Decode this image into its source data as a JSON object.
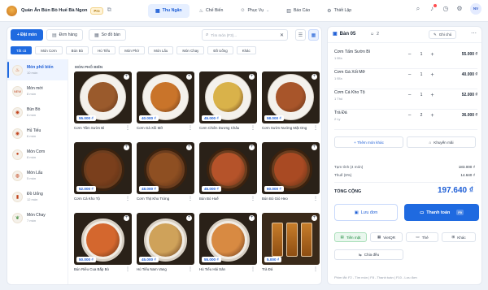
{
  "brand": {
    "name": "Quán Ăn Bún Bò Huế Bà Ngon",
    "badge": "Pro"
  },
  "nav": [
    {
      "label": "Thu Ngân",
      "active": true
    },
    {
      "label": "Chế Biến"
    },
    {
      "label": "Phục Vụ"
    },
    {
      "label": "Báo Cáo"
    },
    {
      "label": "Thiết Lập"
    }
  ],
  "user": {
    "initials": "NV"
  },
  "toolbar": {
    "new_order": "+ Đặt món",
    "orders": "Đơn hàng",
    "table_map": "Sơ đồ bàn",
    "search_placeholder": "Tìm món (F3)..."
  },
  "categories": [
    {
      "label": "Tất cả",
      "active": true
    },
    {
      "label": "Món Cơm"
    },
    {
      "label": "Bún Bò"
    },
    {
      "label": "Hủ Tiếu"
    },
    {
      "label": "Món Phở"
    },
    {
      "label": "Món Lẩu"
    },
    {
      "label": "Món Chay"
    },
    {
      "label": "Đồ Uống"
    },
    {
      "label": "Khác"
    }
  ],
  "sidebar": [
    {
      "name": "Món phổ biến",
      "count": "10 món",
      "active": true
    },
    {
      "name": "Món mới",
      "count": "8 món"
    },
    {
      "name": "Bún Bò",
      "count": "6 món"
    },
    {
      "name": "Hủ Tiếu",
      "count": "6 món"
    },
    {
      "name": "Món Cơm",
      "count": "8 món"
    },
    {
      "name": "Món Lẩu",
      "count": "5 món"
    },
    {
      "name": "Đồ Uống",
      "count": "12 món"
    },
    {
      "name": "Món Chay",
      "count": "7 món"
    }
  ],
  "section_title": "MÓN PHỔ BIẾN",
  "menu_items": [
    {
      "name": "Cơm Tấm Sườn Bì",
      "price": "55.000 ₫",
      "color": "#9a5a2c"
    },
    {
      "name": "Cơm Gà Xối Mỡ",
      "price": "40.000 ₫",
      "color": "#c9742a"
    },
    {
      "name": "Cơm Chiên Dương Châu",
      "price": "45.000 ₫",
      "color": "#d9b24a"
    },
    {
      "name": "Cơm Sườn Nướng Mật Ong",
      "price": "58.000 ₫",
      "color": "#a8552a"
    },
    {
      "name": "Cơm Cá Kho Tộ",
      "price": "52.000 ₫",
      "color": "#7a3f1c"
    },
    {
      "name": "Cơm Thịt Kho Trứng",
      "price": "48.000 ₫",
      "color": "#8e4f22"
    },
    {
      "name": "Bún Bò Huế",
      "price": "45.000 ₫",
      "color": "#b5532a"
    },
    {
      "name": "Bún Bò Giò Heo",
      "price": "60.000 ₫",
      "color": "#a94a23"
    },
    {
      "name": "Bún Riêu Cua Bắp Bò",
      "price": "50.000 ₫",
      "color": "#d4672e"
    },
    {
      "name": "Hủ Tiếu Nam Vang",
      "price": "45.000 ₫",
      "color": "#cfa25a"
    },
    {
      "name": "Hủ Tiếu Hải Sản",
      "price": "55.000 ₫",
      "color": "#d88a42"
    },
    {
      "name": "Trà Đá",
      "price": "5.000 ₫",
      "color": "#a86420"
    }
  ],
  "order": {
    "table": "Bàn 05",
    "guests": "2",
    "note_label": "Ghi chú",
    "items": [
      {
        "name": "Cơm Tấm Sườn Bì",
        "unit": "1 Đĩa",
        "qty": "1",
        "price": "55.000 ₫"
      },
      {
        "name": "Cơm Gà Xối Mỡ",
        "unit": "1 Đĩa",
        "qty": "1",
        "price": "40.000 ₫"
      },
      {
        "name": "Cơm Cá Kho Tộ",
        "unit": "1 Thố",
        "qty": "1",
        "price": "52.000 ₫"
      },
      {
        "name": "Trà Đá",
        "unit": "2 Ly",
        "qty": "2",
        "price": "36.000 ₫"
      }
    ],
    "add_more": "+ Thêm món khác",
    "promo": "Khuyến mãi",
    "subtotal_label": "Tạm tính (4 món)",
    "subtotal": "183.000 ₫",
    "tax_label": "Thuế (8%)",
    "tax": "14.640 ₫",
    "total_label": "TỔNG CỘNG",
    "total": "197.640 ₫",
    "save": "Lưu đơn",
    "pay": "Thanh toán",
    "pay_key": "F9",
    "payment_methods": [
      {
        "label": "Tiền mặt",
        "active": true
      },
      {
        "label": "VietQR"
      },
      {
        "label": "Thẻ"
      },
      {
        "label": "Khác"
      }
    ],
    "split": "Chia đều",
    "shortcuts": "Phím tắt:   F2 - Tìm món   |   F8 - Thanh toán   |   F10 - Lưu đơn"
  }
}
